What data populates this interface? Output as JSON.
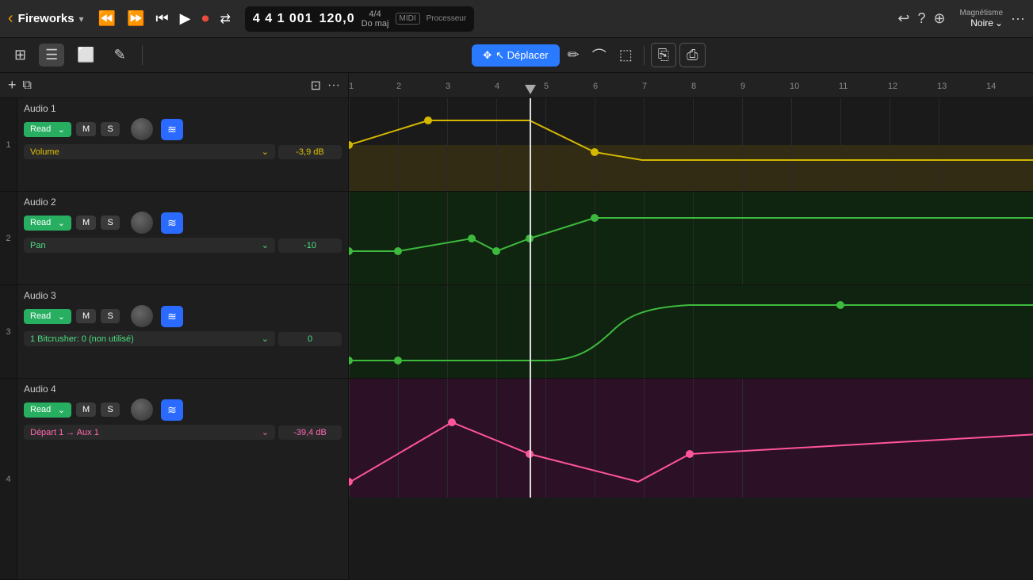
{
  "topbar": {
    "back_label": "‹",
    "project_name": "Fireworks",
    "chevron": "▾",
    "rewind_label": "⏮",
    "fast_backward": "⏪",
    "fast_forward": "⏩",
    "play_label": "▶",
    "record_label": "⏺",
    "loop_label": "⇄",
    "position_beats": "4 4 1 001",
    "position_tempo": "120,0",
    "position_sig_top": "4/4",
    "position_sig_bottom": "Do maj",
    "midi_label": "MIDI",
    "processor_label": "Processeur",
    "icon_undo": "↩",
    "icon_help": "?",
    "icon_more2": "⊕",
    "magnetisme_label": "Magnétisme",
    "magnetisme_value": "Noire",
    "more_label": "···"
  },
  "secondbar": {
    "grid_icon": "⊞",
    "list_icon": "☰",
    "screen_icon": "⬜",
    "pencil_icon": "✎",
    "move_label": "↖ Déplacer",
    "pen_tool": "✒",
    "curve_tool": "⌒",
    "select_rect": "⬚",
    "clipboard1": "⎘",
    "clipboard2": "⎙"
  },
  "tracks": [
    {
      "number": "1",
      "name": "Audio 1",
      "read_label": "Read",
      "m_label": "M",
      "s_label": "S",
      "automation_param": "Volume",
      "automation_value": "-3,9 dB",
      "automation_color": "yellow",
      "lane_height": 118
    },
    {
      "number": "2",
      "name": "Audio 2",
      "read_label": "Read",
      "m_label": "M",
      "s_label": "S",
      "automation_param": "Pan",
      "automation_value": "-10",
      "automation_color": "green",
      "lane_height": 118
    },
    {
      "number": "3",
      "name": "Audio 3",
      "read_label": "Read",
      "m_label": "M",
      "s_label": "S",
      "automation_param": "1 Bitcrusher: 0 (non utilisé)",
      "automation_value": "0",
      "automation_color": "green",
      "lane_height": 118
    },
    {
      "number": "4",
      "name": "Audio 4",
      "read_label": "Read",
      "m_label": "M",
      "s_label": "S",
      "automation_param": "Départ 1 → Aux 1",
      "automation_value": "-39,4 dB",
      "automation_color": "pink",
      "lane_height": 150
    }
  ],
  "ruler": {
    "marks": [
      "1",
      "2",
      "3",
      "4",
      "5",
      "6",
      "7",
      "8",
      "9",
      "10",
      "11",
      "12",
      "13",
      "14"
    ]
  },
  "playhead_position_pct": 26.5
}
